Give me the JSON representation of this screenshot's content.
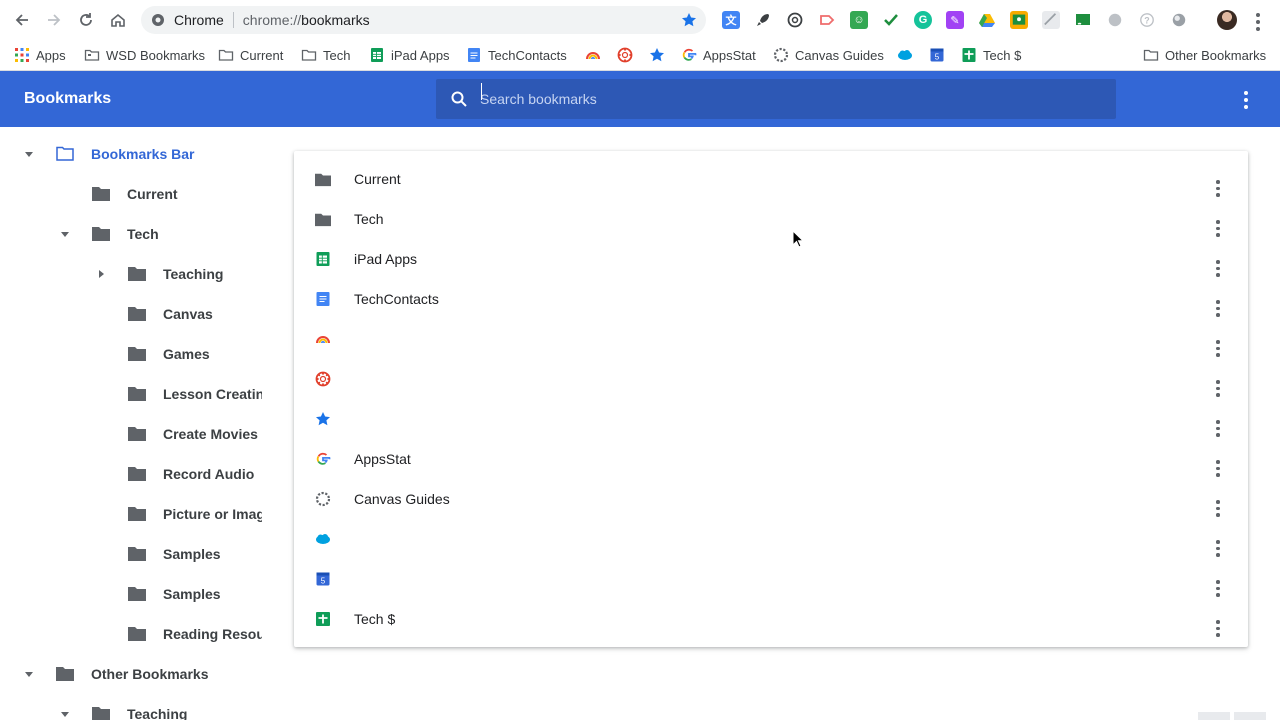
{
  "browser": {
    "site_chip": "Chrome",
    "url_scheme": "chrome://",
    "url_host": "bookmarks",
    "extensions": [
      "translate-icon",
      "rocket-icon",
      "openai-icon",
      "screencastify-icon",
      "clip-icon",
      "check-icon",
      "grammarly-icon",
      "puzzle-icon",
      "drive-icon",
      "classroom-icon",
      "pdf-icon",
      "cast-icon",
      "grey-circle-icon",
      "help-icon",
      "sphere-icon"
    ]
  },
  "bookmarks_bar": {
    "items": [
      {
        "label": "Apps",
        "icon": "apps-grid-icon"
      },
      {
        "label": "WSD Bookmarks",
        "icon": "folder-icon"
      },
      {
        "label": "Current",
        "icon": "folder-icon"
      },
      {
        "label": "Tech",
        "icon": "folder-icon"
      },
      {
        "label": "iPad Apps",
        "icon": "sheets-icon"
      },
      {
        "label": "TechContacts",
        "icon": "docs-icon"
      },
      {
        "label": "",
        "icon": "rainbow-icon"
      },
      {
        "label": "",
        "icon": "canvas-icon"
      },
      {
        "label": "",
        "icon": "star-icon"
      },
      {
        "label": "AppsStat",
        "icon": "google-icon"
      },
      {
        "label": "Canvas Guides",
        "icon": "dotted-circle-icon"
      },
      {
        "label": "",
        "icon": "salesforce-icon"
      },
      {
        "label": "",
        "icon": "calendar-icon"
      },
      {
        "label": "Tech $",
        "icon": "sheets-plus-icon"
      }
    ],
    "other_bookmarks": "Other Bookmarks"
  },
  "manager": {
    "title": "Bookmarks",
    "search_placeholder": "Search bookmarks"
  },
  "sidebar": {
    "items": [
      {
        "label": "Bookmarks Bar",
        "level": 0,
        "expanded": true,
        "selected": true
      },
      {
        "label": "Current",
        "level": 1
      },
      {
        "label": "Tech",
        "level": 1,
        "expanded": true
      },
      {
        "label": "Teaching",
        "level": 2,
        "collapsed": true
      },
      {
        "label": "Canvas",
        "level": 2
      },
      {
        "label": "Games",
        "level": 2
      },
      {
        "label": "Lesson Creating Tools",
        "level": 2
      },
      {
        "label": "Create Movies",
        "level": 2
      },
      {
        "label": "Record Audio",
        "level": 2
      },
      {
        "label": "Picture or Image",
        "level": 2
      },
      {
        "label": "Samples",
        "level": 2
      },
      {
        "label": "Samples",
        "level": 2
      },
      {
        "label": "Reading Resources",
        "level": 2
      },
      {
        "label": "Other Bookmarks",
        "level": 0,
        "expanded": true
      },
      {
        "label": "Teaching",
        "level": 1,
        "expanded": true
      }
    ]
  },
  "list": {
    "items": [
      {
        "label": "Current",
        "icon": "folder-icon"
      },
      {
        "label": "Tech",
        "icon": "folder-icon"
      },
      {
        "label": "iPad Apps",
        "icon": "sheets-icon"
      },
      {
        "label": "TechContacts",
        "icon": "docs-icon"
      },
      {
        "label": "",
        "icon": "rainbow-icon"
      },
      {
        "label": "",
        "icon": "canvas-icon"
      },
      {
        "label": "",
        "icon": "star-icon"
      },
      {
        "label": "AppsStat",
        "icon": "google-icon"
      },
      {
        "label": "Canvas Guides",
        "icon": "dotted-circle-icon"
      },
      {
        "label": "",
        "icon": "salesforce-icon"
      },
      {
        "label": "",
        "icon": "calendar-icon"
      },
      {
        "label": "Tech $",
        "icon": "sheets-plus-icon"
      }
    ]
  },
  "colors": {
    "header_bg": "#3367d6",
    "search_bg": "#2d58b5",
    "folder_grey": "#5f6368",
    "selected_blue": "#3367d6"
  }
}
